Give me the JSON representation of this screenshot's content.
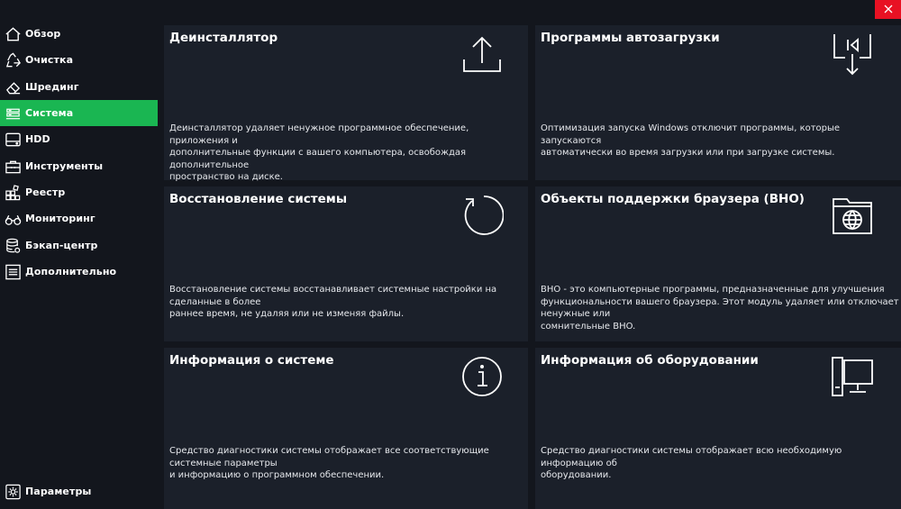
{
  "window": {
    "close_icon": "close-icon"
  },
  "sidebar": {
    "items": [
      {
        "label": "Обзор",
        "icon": "home-icon",
        "active": false
      },
      {
        "label": "Очистка",
        "icon": "recycle-icon",
        "active": false
      },
      {
        "label": "Шрединг",
        "icon": "eraser-icon",
        "active": false
      },
      {
        "label": "Система",
        "icon": "system-icon",
        "active": true
      },
      {
        "label": "HDD",
        "icon": "hdd-icon",
        "active": false
      },
      {
        "label": "Инструменты",
        "icon": "toolbox-icon",
        "active": false
      },
      {
        "label": "Реестр",
        "icon": "registry-icon",
        "active": false
      },
      {
        "label": "Мониторинг",
        "icon": "binoculars-icon",
        "active": false
      },
      {
        "label": "Бэкап-центр",
        "icon": "database-icon",
        "active": false
      },
      {
        "label": "Дополнительно",
        "icon": "list-icon",
        "active": false
      }
    ],
    "settings": {
      "label": "Параметры",
      "icon": "gear-icon"
    },
    "accent": "#1ab652"
  },
  "cards": [
    {
      "title": "Деинсталлятор",
      "icon": "upload-icon",
      "desc": [
        "Деинсталлятор удаляет ненужное программное обеспечение, приложения и",
        "дополнительные функции с вашего компьютера, освобождая дополнительное",
        "пространство на диске."
      ]
    },
    {
      "title": "Программы автозагрузки",
      "icon": "startup-icon",
      "desc": [
        "Оптимизация запуска Windows отключит программы, которые запускаются",
        "автоматически во время загрузки или при загрузке системы."
      ]
    },
    {
      "title": "Восстановление системы",
      "icon": "restore-icon",
      "desc": [
        "Восстановление системы восстанавливает системные настройки на сделанные в более",
        "раннее время, не удаляя или не изменяя файлы."
      ]
    },
    {
      "title": "Объекты поддержки браузера (BHO)",
      "icon": "browser-globe-icon",
      "desc": [
        "BHO - это компьютерные программы, предназначенные для улучшения",
        "функциональности вашего браузера. Этот модуль удаляет или отключает ненужные или",
        "сомнительные BHO."
      ]
    },
    {
      "title": "Информация о системе",
      "icon": "info-icon",
      "desc": [
        "Средство диагностики системы отображает все соответствующие системные параметры",
        "и информацию о программном обеспечении."
      ]
    },
    {
      "title": "Информация об оборудовании",
      "icon": "computer-icon",
      "desc": [
        "Средство диагностики системы отображает всю необходимую информацию об",
        "оборудовании."
      ]
    }
  ],
  "colors": {
    "background": "#13161d",
    "card": "#1b202a",
    "close": "#e81123"
  }
}
